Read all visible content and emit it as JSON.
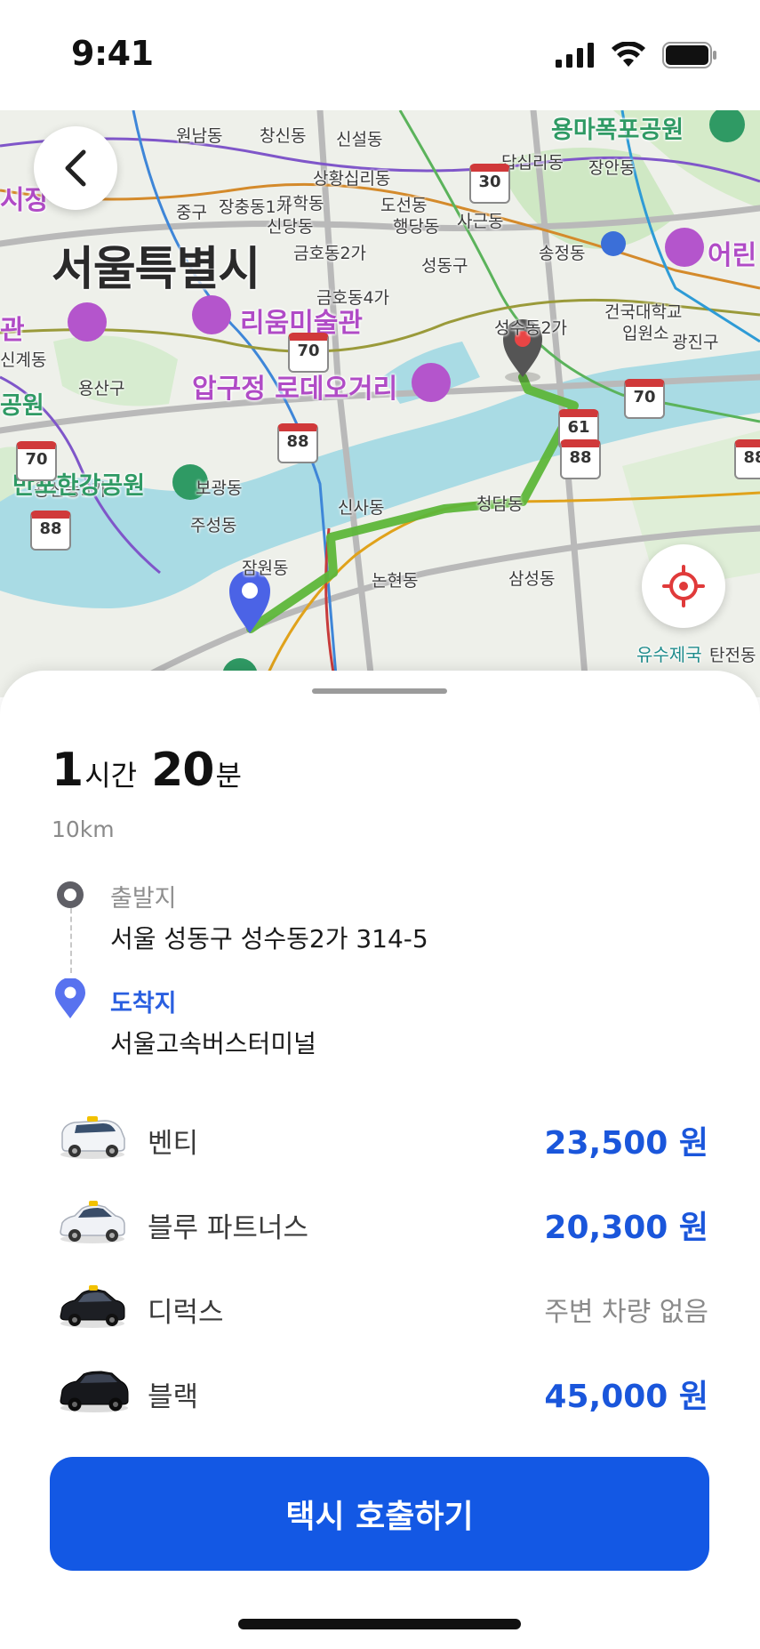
{
  "status_bar": {
    "time": "9:41"
  },
  "map": {
    "labels": {
      "city": "서울특별시",
      "wonnam": "원남동",
      "changsin": "창신동",
      "sinseol": "신설동",
      "dapsimni": "답십리동",
      "jangan": "장안동",
      "sanghwang": "상황십리동",
      "muhak": "무학동",
      "dosun": "도선동",
      "junggu": "중구",
      "jangchung": "장충동1가",
      "sindang": "신당동",
      "haengdang": "행당동",
      "sageun": "사근동",
      "geumho2": "금호동2가",
      "seongdong": "성동구",
      "songjeong": "송정동",
      "gwangjin": "광진구",
      "geumho4": "금호동4가",
      "seongsu": "성수동2가",
      "konkuk": "건국대학교",
      "hospital": "입원소",
      "yongsan": "용산구",
      "yongsan5": "용산동5가",
      "bogwang": "보광동",
      "juseong": "주성동",
      "sinsa": "신사동",
      "cheongdam": "청담동",
      "jamwon": "잠원동",
      "nonhyeon": "논현동",
      "samseong": "삼성동",
      "yusu": "유수제국",
      "tanjeon": "탄전동",
      "sigae": "신계동",
      "gwan": "관",
      "poi_rium": "리움미술관",
      "poi_rodeo": "압구정 로데오거리",
      "poi_market": "시장",
      "poi_children": "어린",
      "park_yongma": "용마폭포공원",
      "park_banpo": "반포한강공원",
      "park_partial": "공원"
    },
    "road_numbers": [
      "30",
      "70",
      "70",
      "88",
      "61",
      "88",
      "70",
      "88",
      "88"
    ],
    "route_color": "#5db63a"
  },
  "trip": {
    "hours": "1",
    "hours_unit": "시간",
    "minutes": "20",
    "minutes_unit": "분",
    "distance": "10km"
  },
  "origin": {
    "label": "출발지",
    "address": "서울 성동구 성수동2가 314-5"
  },
  "destination": {
    "label": "도착지",
    "address": "서울고속버스터미널"
  },
  "rides": [
    {
      "name": "벤티",
      "price": "23,500 원",
      "car": "white-van-icon"
    },
    {
      "name": "블루 파트너스",
      "price": "20,300 원",
      "car": "white-taxi-icon"
    },
    {
      "name": "디럭스",
      "price": "주변 차량 없음",
      "car": "black-taxi-icon"
    },
    {
      "name": "블랙",
      "price": "45,000 원",
      "car": "black-suv-icon"
    }
  ],
  "cta": {
    "label": "택시 호출하기"
  },
  "colors": {
    "accent": "#1358e4",
    "price": "#1a56db",
    "destination": "#2a5fe0"
  }
}
